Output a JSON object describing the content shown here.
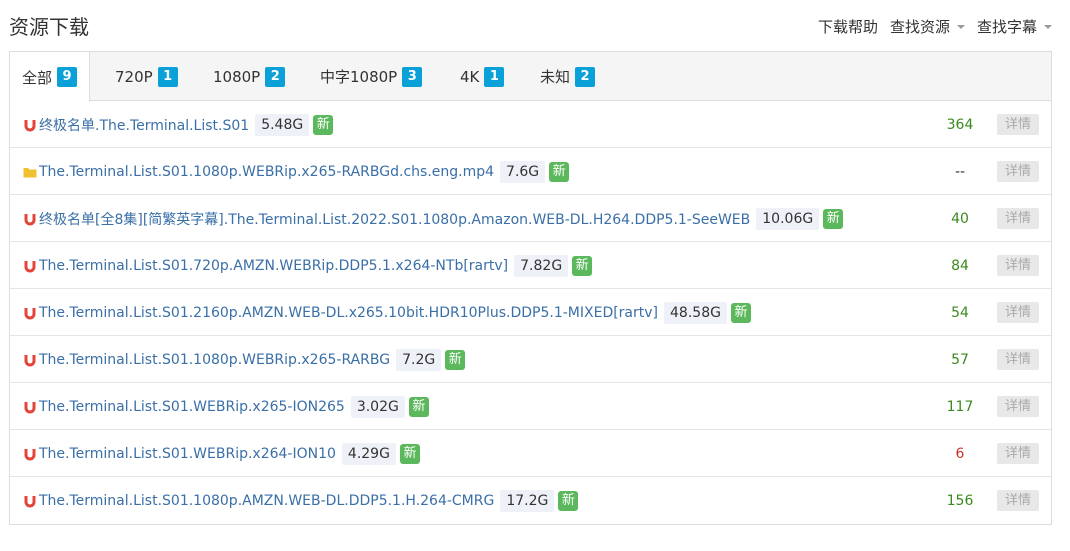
{
  "header": {
    "title": "资源下载",
    "actions": [
      {
        "label": "下载帮助",
        "dropdown": false
      },
      {
        "label": "查找资源",
        "dropdown": true
      },
      {
        "label": "查找字幕",
        "dropdown": true
      }
    ]
  },
  "tabs": [
    {
      "label": "全部",
      "count": "9",
      "active": true
    },
    {
      "label": "720P",
      "count": "1",
      "active": false
    },
    {
      "label": "1080P",
      "count": "2",
      "active": false
    },
    {
      "label": "中字1080P",
      "count": "3",
      "active": false
    },
    {
      "label": "4K",
      "count": "1",
      "active": false
    },
    {
      "label": "未知",
      "count": "2",
      "active": false
    }
  ],
  "colors": {
    "badge_blue": "#0aa0d8",
    "link": "#3a6fa7",
    "new_green": "#5cb85c",
    "score_green": "#3b8a1e",
    "score_red": "#c9302c",
    "magnet_red": "#e4453a",
    "folder_yellow": "#f0c030"
  },
  "rows": [
    {
      "icon": "magnet-icon",
      "name": "终极名单.The.Terminal.List.S01",
      "size": "5.48G",
      "new": "新",
      "score": "364",
      "score_color": "green",
      "detail": "详情"
    },
    {
      "icon": "folder-icon",
      "name": "The.Terminal.List.S01.1080p.WEBRip.x265-RARBGd.chs.eng.mp4",
      "size": "7.6G",
      "new": "新",
      "score": "--",
      "score_color": "gray",
      "detail": "详情"
    },
    {
      "icon": "magnet-icon",
      "name": "终极名单[全8集][简繁英字幕].The.Terminal.List.2022.S01.1080p.Amazon.WEB-DL.H264.DDP5.1-SeeWEB",
      "size": "10.06G",
      "new": "新",
      "score": "40",
      "score_color": "green",
      "detail": "详情"
    },
    {
      "icon": "magnet-icon",
      "name": "The.Terminal.List.S01.720p.AMZN.WEBRip.DDP5.1.x264-NTb[rartv]",
      "size": "7.82G",
      "new": "新",
      "score": "84",
      "score_color": "green",
      "detail": "详情"
    },
    {
      "icon": "magnet-icon",
      "name": "The.Terminal.List.S01.2160p.AMZN.WEB-DL.x265.10bit.HDR10Plus.DDP5.1-MIXED[rartv]",
      "size": "48.58G",
      "new": "新",
      "score": "54",
      "score_color": "green",
      "detail": "详情"
    },
    {
      "icon": "magnet-icon",
      "name": "The.Terminal.List.S01.1080p.WEBRip.x265-RARBG",
      "size": "7.2G",
      "new": "新",
      "score": "57",
      "score_color": "green",
      "detail": "详情"
    },
    {
      "icon": "magnet-icon",
      "name": "The.Terminal.List.S01.WEBRip.x265-ION265",
      "size": "3.02G",
      "new": "新",
      "score": "117",
      "score_color": "green",
      "detail": "详情"
    },
    {
      "icon": "magnet-icon",
      "name": "The.Terminal.List.S01.WEBRip.x264-ION10",
      "size": "4.29G",
      "new": "新",
      "score": "6",
      "score_color": "red",
      "detail": "详情"
    },
    {
      "icon": "magnet-icon",
      "name": "The.Terminal.List.S01.1080p.AMZN.WEB-DL.DDP5.1.H.264-CMRG",
      "size": "17.2G",
      "new": "新",
      "score": "156",
      "score_color": "green",
      "detail": "详情"
    }
  ]
}
